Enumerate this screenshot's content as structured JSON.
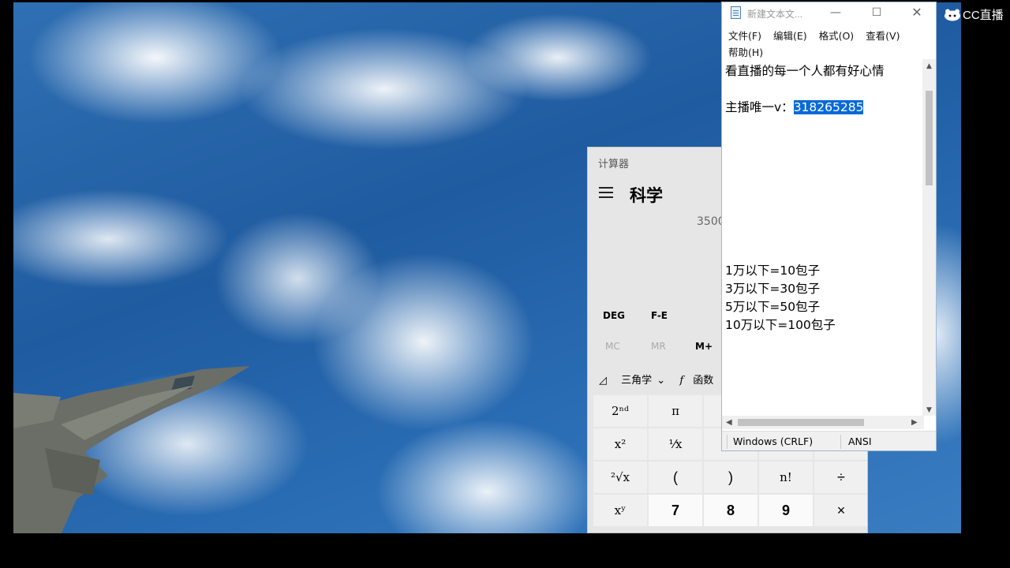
{
  "watermark": {
    "icon": "cc-logo-icon",
    "text": "CC直播"
  },
  "calculator": {
    "title": "计算器",
    "mode": "科学",
    "display_partial": "3500",
    "angle_row": [
      "DEG",
      "F-E"
    ],
    "memory_row": [
      "MC",
      "MR",
      "M+"
    ],
    "function_row": [
      "三角学",
      "函数"
    ],
    "keys": [
      [
        "2ⁿᵈ",
        "π",
        "",
        "",
        ""
      ],
      [
        "x²",
        "¹⁄x",
        "",
        "",
        ""
      ],
      [
        "²√x",
        "(",
        ")",
        "n!",
        "÷"
      ],
      [
        "xʸ",
        "7",
        "8",
        "9",
        "×"
      ]
    ]
  },
  "notepad": {
    "title": "新建文本文...",
    "menu": [
      "文件(F)",
      "编辑(E)",
      "格式(O)",
      "查看(V)",
      "帮助(H)"
    ],
    "lines": {
      "line1": "看直播的每一个人都有好心情",
      "line2_prefix": "主播唯一v：",
      "line2_selected": "318265285",
      "price1": "1万以下=10包子",
      "price2": "3万以下=30包子",
      "price3": "5万以下=50包子",
      "price4": "10万以下=100包子"
    },
    "status": {
      "line_ending": "Windows (CRLF)",
      "encoding": "ANSI"
    }
  }
}
